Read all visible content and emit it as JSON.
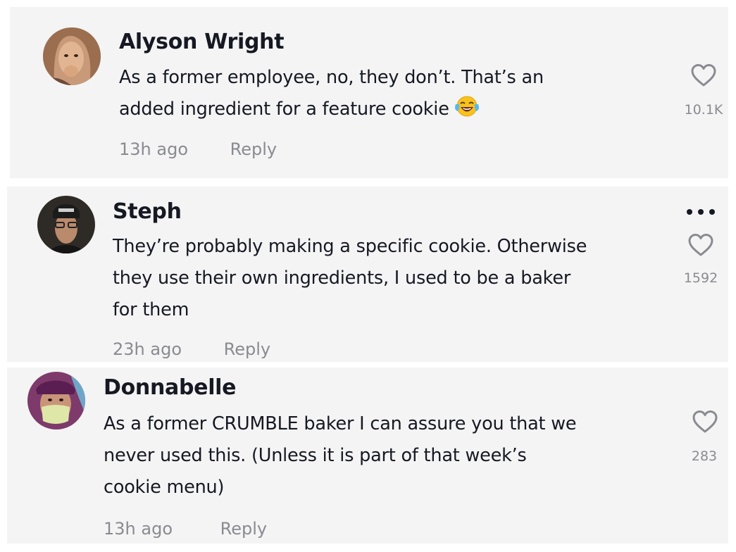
{
  "comments": [
    {
      "username": "Alyson Wright",
      "lines": [
        "As a former employee, no, they don’t. That’s an",
        "added ingredient for a feature cookie"
      ],
      "emoji": "face-with-tears-of-joy",
      "time": "13h ago",
      "reply_label": "Reply",
      "likes": "10.1K"
    },
    {
      "username": "Steph",
      "lines": [
        "They’re probably making a specific cookie. Otherwise",
        "they use their own ingredients, I used to be a baker",
        "for them"
      ],
      "time": "23h ago",
      "reply_label": "Reply",
      "likes": "1592",
      "more_icon": "more-options-icon"
    },
    {
      "username": "Donnabelle",
      "lines": [
        "As a former CRUMBLE baker I can assure you that we",
        "never used this. (Unless it is part of that week’s",
        "cookie menu)"
      ],
      "time": "13h ago",
      "reply_label": "Reply",
      "likes": "283"
    }
  ],
  "colors": {
    "card_bg": "#f4f4f4",
    "text_primary": "#161823",
    "text_secondary": "#8a8b91"
  }
}
